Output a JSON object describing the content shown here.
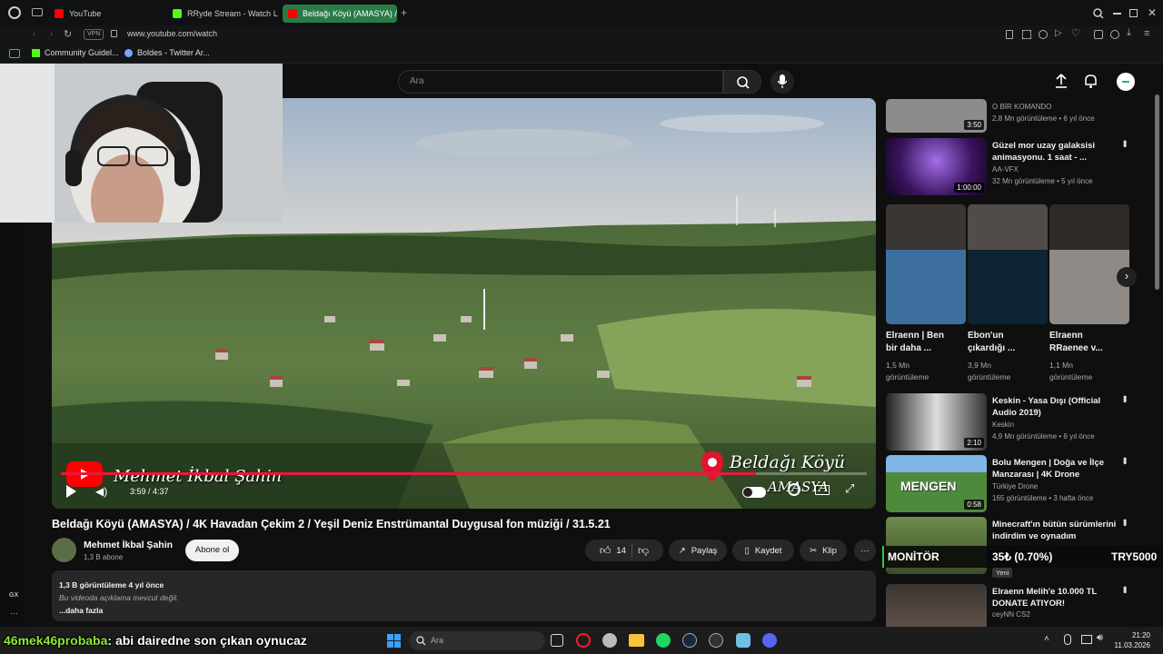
{
  "colors": {
    "accent_green": "#33c13a",
    "yt_red": "#ff0000",
    "progress_red": "#e8193a"
  },
  "browser": {
    "tabs": [
      {
        "label": "YouTube",
        "active": false
      },
      {
        "label": "RRyde Stream - Watch Li",
        "active": false
      },
      {
        "label": "Beldağı Köyü (AMASYA) /",
        "active": true
      }
    ],
    "vpn_label": "VPN",
    "url": "www.youtube.com/watch",
    "bookmarks": [
      {
        "label": "Community Guidel..."
      },
      {
        "label": "Boldes - Twitter Ar..."
      }
    ],
    "left_strip_label": "GX"
  },
  "youtube": {
    "search_placeholder": "Ara",
    "player": {
      "time": "3:59 / 4:37",
      "progress": 0.863,
      "overlay_name": "Mehmet İkbal Şahin",
      "overlay_place": "Beldağı Köyü",
      "overlay_region": "AMASYA"
    },
    "video": {
      "title": "Beldağı Köyü (AMASYA) / 4K Havadan Çekim 2 / Yeşil Deniz Enstrümantal Duygusal fon müziği / 31.5.21",
      "channel": "Mehmet İkbal Şahin",
      "subs": "1,3 B abone",
      "subscribe_label": "Abone ol",
      "likes": "14",
      "share_label": "Paylaş",
      "save_label": "Kaydet",
      "clip_label": "Klip",
      "description": {
        "stats": "1,3 B görüntüleme  4 yıl önce",
        "text": "Bu videoda açıklama mevcut değil.",
        "more": "...daha fazla"
      }
    },
    "recommendations": [
      {
        "title": "",
        "channel": "O BİR KOMANDO",
        "meta": "2,8 Mn görüntüleme • 6 yıl önce",
        "duration": "3:50"
      },
      {
        "title": "Güzel mor uzay galaksisi animasyonu. 1 saat - ...",
        "channel": "AA-VFX",
        "meta": "32 Mn görüntüleme • 5 yıl önce",
        "duration": "1:00:00"
      },
      {
        "title": "Keskin - Yasa Dışı (Official Audio 2019)",
        "channel": "Keskin",
        "meta": "4,9 Mn görüntüleme • 6 yıl önce",
        "duration": "2:10"
      },
      {
        "title": "Bolu Mengen | Doğa ve İlçe Manzarası | 4K Drone",
        "channel": "Türkiye Drone",
        "meta": "165 görüntüleme • 3 hafta önce",
        "duration": "0:58",
        "thumb_text": "MENGEN"
      },
      {
        "title": "Minecraft'ın bütün sürümlerini indirdim ve oynadım",
        "channel": "",
        "meta": "",
        "duration": "",
        "badge": "Yeni"
      },
      {
        "title": "Elraenn Melih'e 10.000 TL DONATE ATIYOR!",
        "channel": "ceyNN CS2",
        "meta": "",
        "duration": ""
      }
    ],
    "shorts": [
      {
        "title": "Elraenn | Ben bir daha ...",
        "views": "1,5 Mn görüntüleme"
      },
      {
        "title": "Ebon'un çıkardığı ...",
        "views": "3,9 Mn görüntüleme"
      },
      {
        "title": "Elraenn RRaenee v...",
        "views": "1,1 Mn görüntüleme"
      }
    ]
  },
  "overlay": {
    "chat_user": "46mek46probaba",
    "chat_message": ": abi dairedne son çıkan oynucaz",
    "monitor_label": "MONİTÖR",
    "monitor_change": "35₺ (0.70%)",
    "monitor_value": "TRY5000"
  },
  "taskbar": {
    "search_placeholder": "Ara",
    "time": "21:20",
    "date": "11.03.2026"
  }
}
